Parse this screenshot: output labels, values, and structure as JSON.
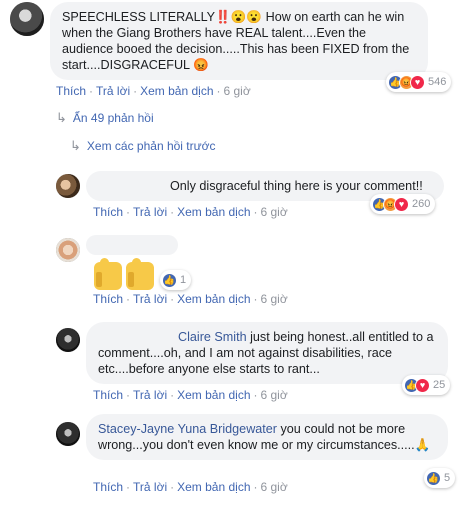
{
  "top_comment": {
    "text": "SPEECHLESS LITERALLY‼️😮😮 How on earth can he win when the Giang Brothers have REAL talent....Even the audience booed the decision.....This has been FIXED from the start....DISGRACEFUL 😡",
    "actions": {
      "like": "Thích",
      "reply": "Trả lời",
      "translate": "Xem bản dịch",
      "time": "6 giờ"
    },
    "reactions": {
      "count": "546"
    }
  },
  "hide_replies": "Ẩn 49 phản hồi",
  "prev_replies": "Xem các phản hồi trước",
  "replies": [
    {
      "text": "Only disgraceful thing here is your comment!!",
      "actions": {
        "like": "Thích",
        "reply": "Trả lời",
        "translate": "Xem bản dịch",
        "time": "6 giờ"
      },
      "reactions": {
        "count": "260"
      }
    },
    {
      "actions": {
        "like": "Thích",
        "reply": "Trả lời",
        "translate": "Xem bản dịch",
        "time": "6 giờ"
      },
      "reactions": {
        "count": "1"
      }
    },
    {
      "mention": "Claire Smith",
      "text": " just being honest..all entitled to a comment....oh, and I am not against disabilities, race etc....before anyone else starts to rant...",
      "actions": {
        "like": "Thích",
        "reply": "Trả lời",
        "translate": "Xem bản dịch",
        "time": "6 giờ"
      },
      "reactions": {
        "count": "25"
      }
    },
    {
      "mention": "Stacey-Jayne Yuna Bridgewater",
      "text": " you could not be more wrong...you don't even know me or my circumstances.....🙏",
      "actions": {
        "like": "Thích",
        "reply": "Trả lời",
        "translate": "Xem bản dịch",
        "time": "6 giờ"
      },
      "reactions": {
        "count": "5"
      }
    }
  ],
  "icons": {
    "hide": "corner-arrow-icon",
    "prev": "corner-arrow-icon"
  },
  "colors": {
    "link": "#4267b2",
    "bubble": "#f2f3f5",
    "like": "#4267b2",
    "love": "#f0284a",
    "angry": "#f29b3f"
  }
}
